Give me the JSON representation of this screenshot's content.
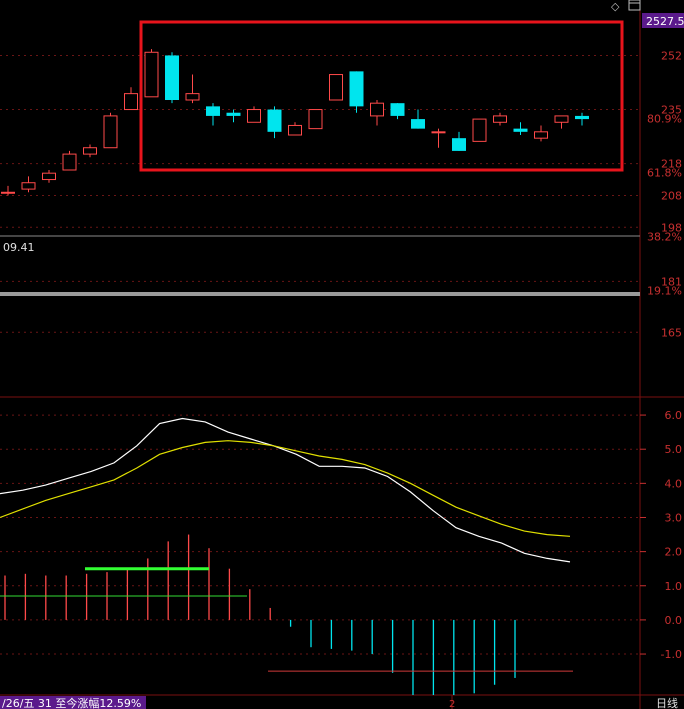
{
  "header": {
    "price_badge": "2527.5",
    "icons": [
      "diamond-icon",
      "window-icon"
    ]
  },
  "price_panel": {
    "ylim": [
      150,
      260
    ],
    "tick_labels": [
      "252",
      "235",
      "218",
      "208",
      "198",
      "181",
      "165"
    ],
    "pct_labels": [
      "80.9%",
      "61.8%",
      "38.2%",
      "19.1%"
    ],
    "value_label": "09.41",
    "highlight_color": "#e8141c"
  },
  "chart_data": [
    {
      "type": "candlestick",
      "ylim": [
        150,
        260
      ],
      "candles": [
        {
          "o": 209,
          "c": 209,
          "h": 211,
          "l": 208
        },
        {
          "o": 210,
          "c": 212,
          "h": 214,
          "l": 209
        },
        {
          "o": 213,
          "c": 215,
          "h": 216,
          "l": 212
        },
        {
          "o": 216,
          "c": 221,
          "h": 222,
          "l": 216
        },
        {
          "o": 221,
          "c": 223,
          "h": 224,
          "l": 220
        },
        {
          "o": 223,
          "c": 233,
          "h": 234,
          "l": 223
        },
        {
          "o": 235,
          "c": 240,
          "h": 242,
          "l": 235
        },
        {
          "o": 239,
          "c": 253,
          "h": 254,
          "l": 239
        },
        {
          "o": 252,
          "c": 238,
          "h": 253,
          "l": 237
        },
        {
          "o": 238,
          "c": 240,
          "h": 246,
          "l": 237
        },
        {
          "o": 236,
          "c": 233,
          "h": 237,
          "l": 230
        },
        {
          "o": 234,
          "c": 233,
          "h": 235,
          "l": 231
        },
        {
          "o": 231,
          "c": 235,
          "h": 236,
          "l": 231
        },
        {
          "o": 235,
          "c": 228,
          "h": 236,
          "l": 226
        },
        {
          "o": 227,
          "c": 230,
          "h": 231,
          "l": 227
        },
        {
          "o": 229,
          "c": 235,
          "h": 235,
          "l": 229
        },
        {
          "o": 238,
          "c": 246,
          "h": 246,
          "l": 238
        },
        {
          "o": 247,
          "c": 236,
          "h": 247,
          "l": 234
        },
        {
          "o": 233,
          "c": 237,
          "h": 238,
          "l": 230
        },
        {
          "o": 237,
          "c": 233,
          "h": 237,
          "l": 232
        },
        {
          "o": 232,
          "c": 229,
          "h": 235,
          "l": 229
        },
        {
          "o": 228,
          "c": 228,
          "h": 229,
          "l": 223
        },
        {
          "o": 226,
          "c": 222,
          "h": 228,
          "l": 222
        },
        {
          "o": 225,
          "c": 232,
          "h": 232,
          "l": 225
        },
        {
          "o": 231,
          "c": 233,
          "h": 234,
          "l": 230
        },
        {
          "o": 229,
          "c": 228,
          "h": 231,
          "l": 227
        },
        {
          "o": 226,
          "c": 228,
          "h": 230,
          "l": 225
        },
        {
          "o": 231,
          "c": 233,
          "h": 233,
          "l": 229
        },
        {
          "o": 233,
          "c": 232,
          "h": 234,
          "l": 230
        }
      ]
    },
    {
      "type": "line",
      "ylim": [
        -2.2,
        6.5
      ],
      "tick_labels": [
        "6.0",
        "5.0",
        "4.0",
        "3.0",
        "2.0",
        "1.0",
        "0.0",
        "-1.0"
      ],
      "series": [
        {
          "color": "#ffffff",
          "values": [
            3.7,
            3.8,
            3.95,
            4.15,
            4.35,
            4.6,
            5.1,
            5.75,
            5.9,
            5.8,
            5.5,
            5.3,
            5.1,
            4.85,
            4.5,
            4.5,
            4.45,
            4.2,
            3.75,
            3.2,
            2.7,
            2.45,
            2.25,
            1.95,
            1.8,
            1.7
          ]
        },
        {
          "color": "#e0e000",
          "values": [
            3.0,
            3.25,
            3.5,
            3.7,
            3.9,
            4.1,
            4.45,
            4.85,
            5.05,
            5.2,
            5.25,
            5.2,
            5.1,
            4.95,
            4.8,
            4.7,
            4.55,
            4.3,
            4.0,
            3.65,
            3.3,
            3.05,
            2.8,
            2.6,
            2.5,
            2.45
          ]
        }
      ]
    },
    {
      "type": "bar",
      "ylim": [
        -2.2,
        6.5
      ],
      "values": [
        1.3,
        1.35,
        1.3,
        1.3,
        1.35,
        1.4,
        1.5,
        1.8,
        2.3,
        2.5,
        2.1,
        1.5,
        0.9,
        0.35,
        -0.2,
        -0.8,
        -0.85,
        -0.9,
        -1.0,
        -1.55,
        -2.2,
        -2.2,
        -2.2,
        -2.15,
        -1.9,
        -1.7
      ],
      "markers": [
        {
          "kind": "upper",
          "value": 1.5
        },
        {
          "kind": "mid",
          "value": 0.7
        },
        {
          "kind": "lower",
          "value": -1.5
        }
      ]
    }
  ],
  "footer": {
    "status_text": "/26/五 31 至今涨幅12.59%",
    "cursor_label": "2",
    "period_label": "日线"
  }
}
